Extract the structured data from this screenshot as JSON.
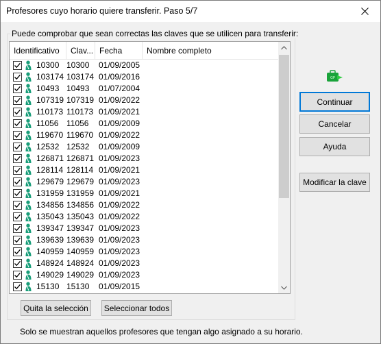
{
  "window": {
    "title": "Profesores cuyo horario quiere transferir. Paso 5/7"
  },
  "group": {
    "label": "Puede comprobar que sean correctas las claves que se utilicen para transferir:"
  },
  "list": {
    "columns": [
      "Identificativo",
      "Clav...",
      "Fecha",
      "Nombre completo"
    ],
    "rows": [
      {
        "id": "10300",
        "clave": "10300",
        "fecha": "01/09/2005",
        "checked": true
      },
      {
        "id": "103174",
        "clave": "103174",
        "fecha": "01/09/2016",
        "checked": true
      },
      {
        "id": "10493",
        "clave": "10493",
        "fecha": "01/07/2004",
        "checked": true
      },
      {
        "id": "107319",
        "clave": "107319",
        "fecha": "01/09/2022",
        "checked": true
      },
      {
        "id": "110173",
        "clave": "110173",
        "fecha": "01/09/2021",
        "checked": true
      },
      {
        "id": "11056",
        "clave": "11056",
        "fecha": "01/09/2009",
        "checked": true
      },
      {
        "id": "119670",
        "clave": "119670",
        "fecha": "01/09/2022",
        "checked": true
      },
      {
        "id": "12532",
        "clave": "12532",
        "fecha": "01/09/2009",
        "checked": true
      },
      {
        "id": "126871",
        "clave": "126871",
        "fecha": "01/09/2023",
        "checked": true
      },
      {
        "id": "128114",
        "clave": "128114",
        "fecha": "01/09/2021",
        "checked": true
      },
      {
        "id": "129679",
        "clave": "129679",
        "fecha": "01/09/2023",
        "checked": true
      },
      {
        "id": "131959",
        "clave": "131959",
        "fecha": "01/09/2021",
        "checked": true
      },
      {
        "id": "134856",
        "clave": "134856",
        "fecha": "01/09/2022",
        "checked": true
      },
      {
        "id": "135043",
        "clave": "135043",
        "fecha": "01/09/2022",
        "checked": true
      },
      {
        "id": "139347",
        "clave": "139347",
        "fecha": "01/09/2023",
        "checked": true
      },
      {
        "id": "139639",
        "clave": "139639",
        "fecha": "01/09/2023",
        "checked": true
      },
      {
        "id": "140959",
        "clave": "140959",
        "fecha": "01/09/2023",
        "checked": true
      },
      {
        "id": "148924",
        "clave": "148924",
        "fecha": "01/09/2023",
        "checked": true
      },
      {
        "id": "149029",
        "clave": "149029",
        "fecha": "01/09/2023",
        "checked": true
      },
      {
        "id": "15130",
        "clave": "15130",
        "fecha": "01/09/2015",
        "checked": true
      }
    ]
  },
  "buttons": {
    "continuar": "Continuar",
    "cancelar": "Cancelar",
    "ayuda": "Ayuda",
    "modificar": "Modificar la clave",
    "quitar": "Quita la selección",
    "seleccionar": "Seleccionar todos"
  },
  "footer": {
    "note": "Solo se muestran aquellos profesores que tengan algo asignado a su horario."
  },
  "colors": {
    "accent": "#0078d7",
    "person_icon": "#1a9e7a",
    "app_icon": "#1aa33a"
  }
}
